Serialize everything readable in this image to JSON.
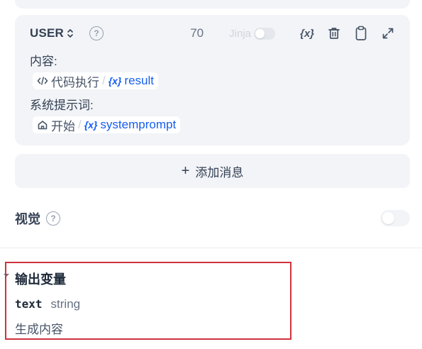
{
  "message": {
    "role": "USER",
    "token_count": "70",
    "jinja_label": "Jinja",
    "var_button": "{x}",
    "fields": [
      {
        "label": "内容:",
        "node": "代码执行",
        "sep": "/",
        "var_symbol": "{x}",
        "var": "result"
      },
      {
        "label": "系统提示词:",
        "node": "开始",
        "sep": "/",
        "var_symbol": "{x}",
        "var": "systemprompt"
      }
    ]
  },
  "add_message": {
    "icon": "+",
    "label": "添加消息"
  },
  "vision": {
    "label": "视觉",
    "help": "?",
    "enabled": false
  },
  "role_help": "?",
  "output": {
    "title": "输出变量",
    "var_name": "text",
    "var_type": "string",
    "description": "生成内容"
  },
  "icons": {
    "chevron": "updown-chevron-icon",
    "help": "help-circle-icon",
    "variable": "variable-icon",
    "delete": "trash-icon",
    "copy": "clipboard-icon",
    "expand": "expand-icon",
    "code": "code-icon",
    "home": "home-icon",
    "caret": "caret-down-icon"
  },
  "colors": {
    "accent": "#155eef",
    "highlight_border": "#d0323c",
    "card_bg": "#f2f4f7"
  }
}
